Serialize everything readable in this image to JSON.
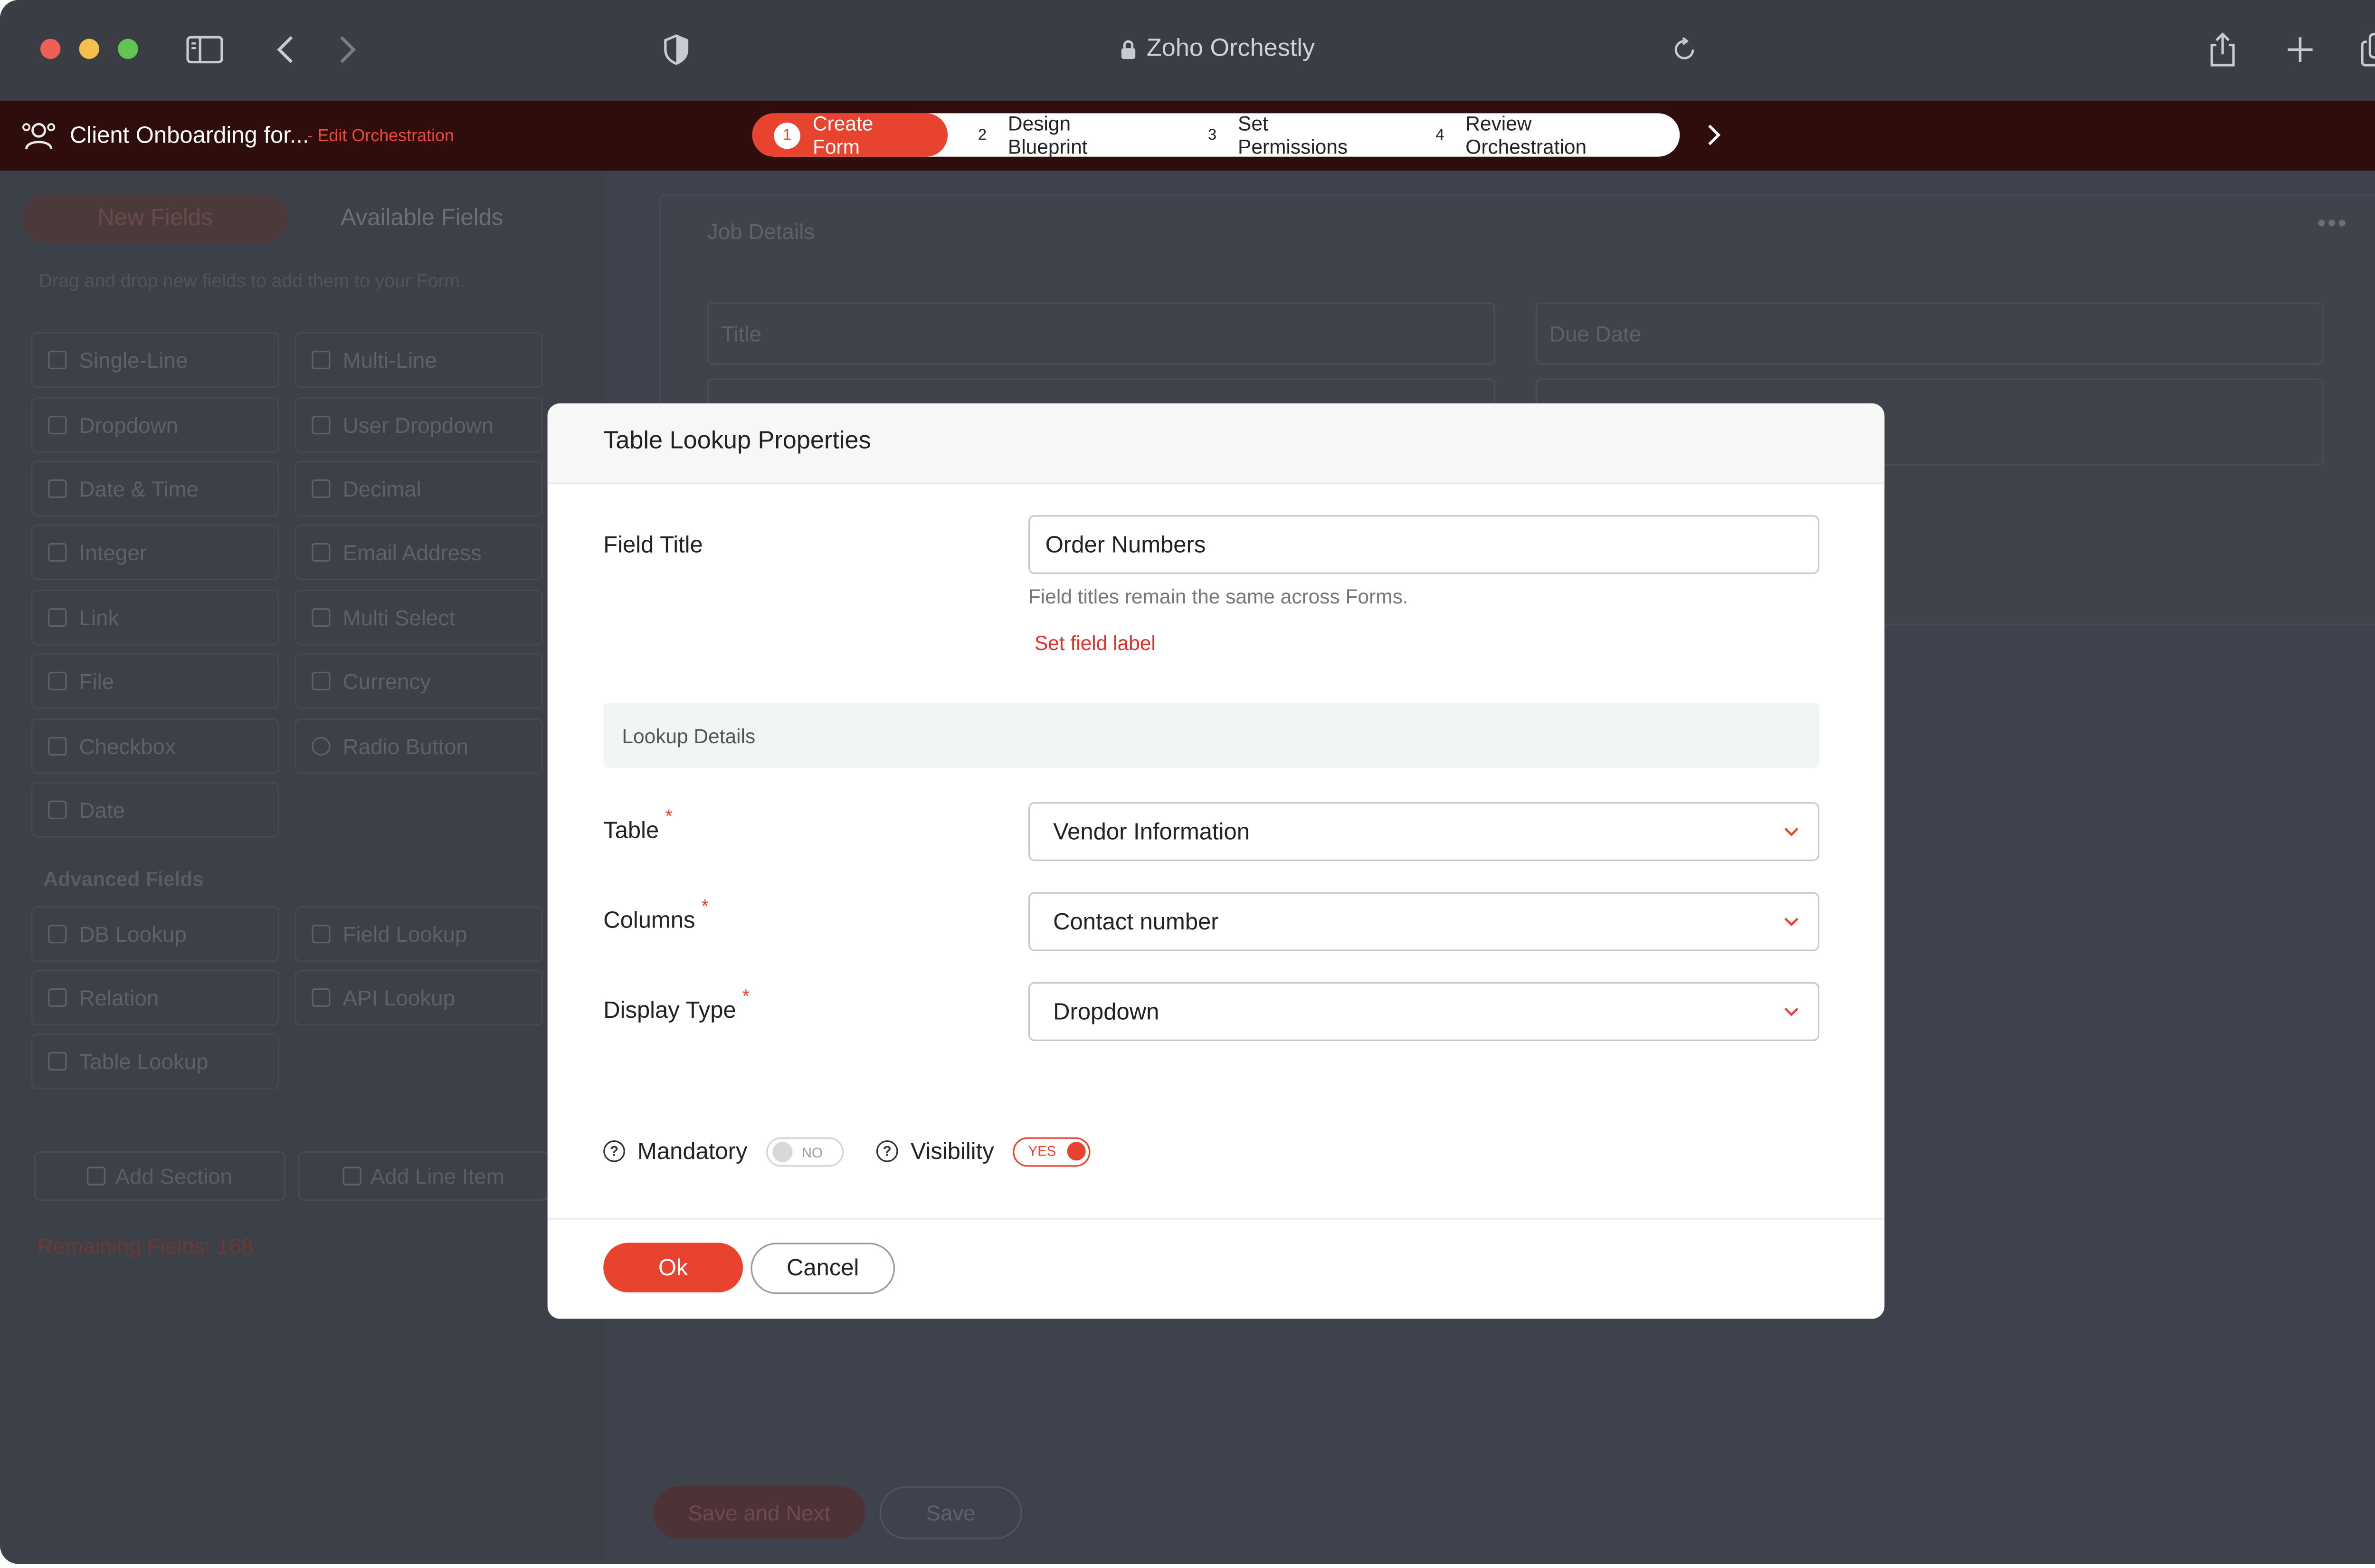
{
  "browser": {
    "address": "Zoho Orchestly",
    "lock_icon": "lock-icon",
    "colors": {
      "close": "#ed5f57",
      "minimize": "#f4bf4f",
      "zoom": "#61c554"
    }
  },
  "app_header": {
    "title": "Client Onboarding for...",
    "subtitle": "- Edit Orchestration",
    "steps": [
      {
        "num": "1",
        "label": "Create Form"
      },
      {
        "num": "2",
        "label": "Design Blueprint"
      },
      {
        "num": "3",
        "label": "Set Permissions"
      },
      {
        "num": "4",
        "label": "Review Orchestration"
      }
    ],
    "accent": "#e8432f"
  },
  "sidebar": {
    "tabs": [
      "New Fields",
      "Available Fields"
    ],
    "hint": "Drag and drop new fields to add them to your Form.",
    "fields": [
      "Single-Line",
      "Multi-Line",
      "Dropdown",
      "User Dropdown",
      "Date & Time",
      "Decimal",
      "Integer",
      "Email Address",
      "Link",
      "Multi Select",
      "File",
      "Currency",
      "Checkbox",
      "Radio Button",
      "Date"
    ],
    "advanced_title": "Advanced Fields",
    "advanced_fields": [
      "DB Lookup",
      "Field Lookup",
      "Relation",
      "API Lookup",
      "Table Lookup"
    ],
    "add_section": "Add Section",
    "add_line_item": "Add Line Item",
    "remaining": "Remaining Fields: 168"
  },
  "canvas": {
    "section_title": "Job Details",
    "fields": [
      "Title",
      "Due Date"
    ],
    "save_next": "Save and Next",
    "save": "Save"
  },
  "modal": {
    "title": "Table Lookup Properties",
    "field_title_label": "Field Title",
    "field_title_value": "Order Numbers",
    "field_title_hint": "Field titles remain the same across Forms.",
    "set_label_link": "Set field label",
    "lookup_section": "Lookup Details",
    "table_label": "Table",
    "table_value": "Vendor Information",
    "columns_label": "Columns",
    "columns_value": "Contact number",
    "display_type_label": "Display Type",
    "display_type_value": "Dropdown",
    "required_mark": "*",
    "mandatory_label": "Mandatory",
    "mandatory_state": "NO",
    "visibility_label": "Visibility",
    "visibility_state": "YES",
    "ok": "Ok",
    "cancel": "Cancel"
  }
}
